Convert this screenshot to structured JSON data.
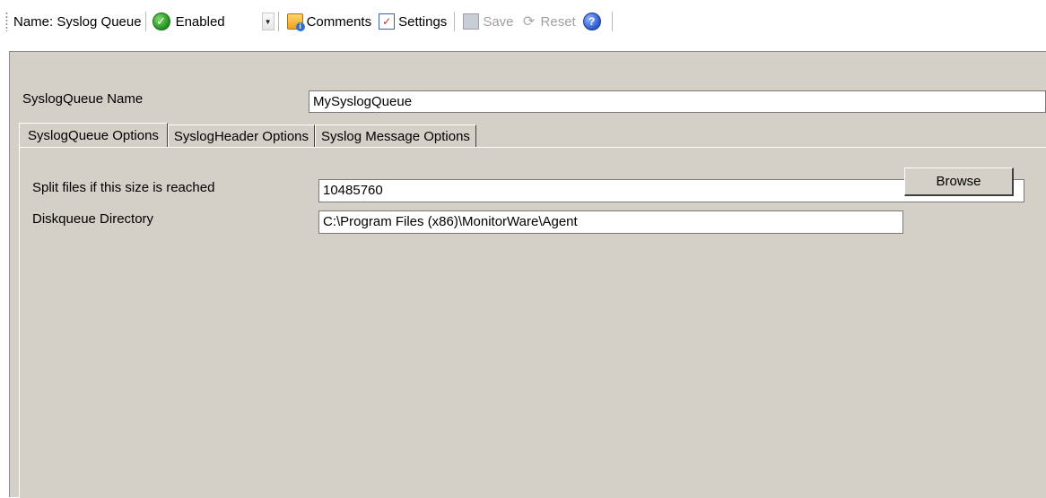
{
  "toolbar": {
    "name_label": "Name: Syslog Queue",
    "status_select": {
      "value": "Enabled",
      "icon": "check-circle-icon"
    },
    "buttons": {
      "comments": "Comments",
      "settings": "Settings",
      "save": "Save",
      "reset": "Reset"
    },
    "icons": {
      "comments": "comments-icon",
      "settings": "settings-icon",
      "save": "save-icon",
      "reset": "reset-icon",
      "help": "help-icon"
    }
  },
  "form": {
    "name_label": "SyslogQueue Name",
    "name_value": "MySyslogQueue"
  },
  "tabs": [
    {
      "label": "SyslogQueue Options",
      "active": true
    },
    {
      "label": "SyslogHeader Options",
      "active": false
    },
    {
      "label": "Syslog Message Options",
      "active": false
    }
  ],
  "options": {
    "split_label": "Split files if this size is reached",
    "split_value": "10485760",
    "dir_label": "Diskqueue Directory",
    "dir_value": "C:\\Program Files (x86)\\MonitorWare\\Agent",
    "browse_label": "Browse"
  },
  "colors": {
    "panel_bg": "#d4d0c8",
    "toolbar_bg": "#ffffff",
    "enabled_green": "#1e8f1e"
  }
}
